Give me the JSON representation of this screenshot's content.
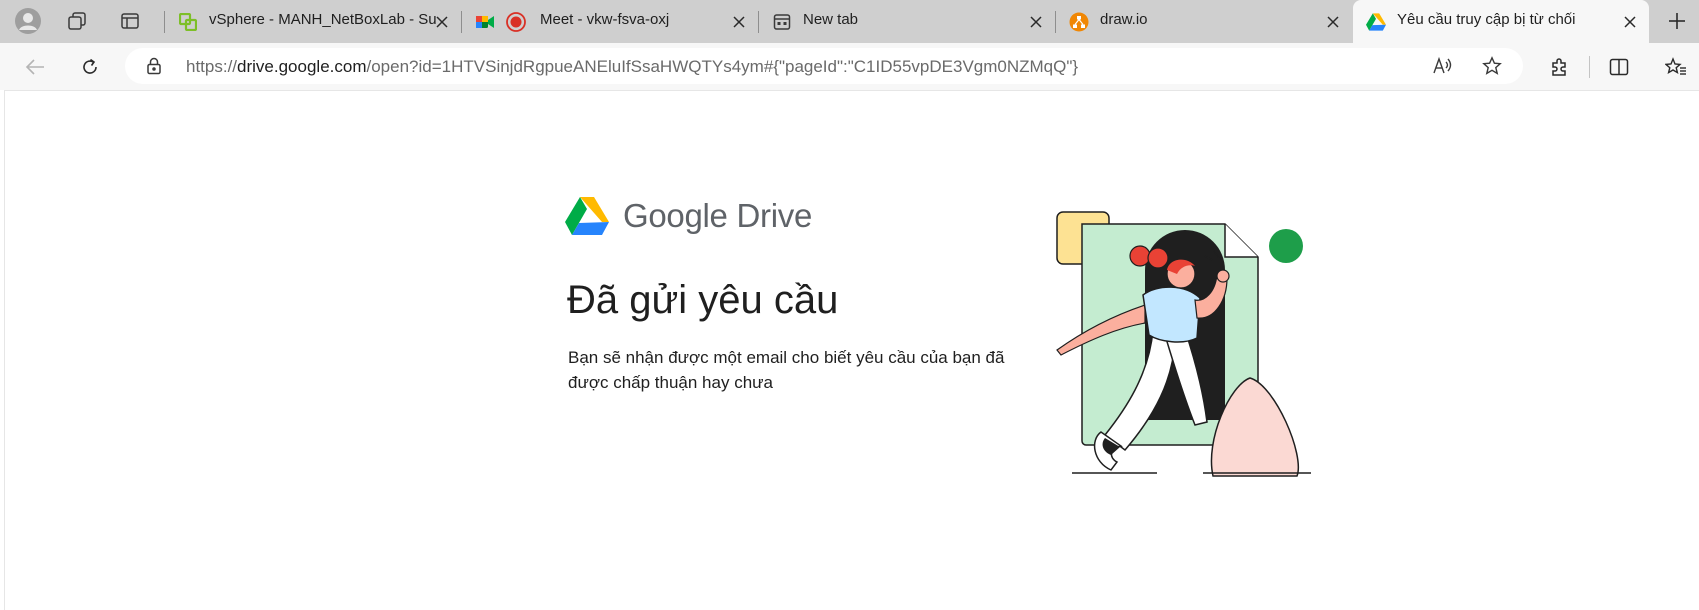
{
  "browser": {
    "tabs": [
      {
        "title": "vSphere - MANH_NetBoxLab - Su",
        "favicon": "vsphere-icon",
        "active": false
      },
      {
        "title": "Meet - vkw-fsva-oxj",
        "favicon": "google-meet-icon",
        "active": false,
        "recording": true
      },
      {
        "title": "New tab",
        "favicon": "new-tab-icon",
        "active": false
      },
      {
        "title": "draw.io",
        "favicon": "drawio-icon",
        "active": false
      },
      {
        "title": "Yêu cầu truy cập bị từ chối",
        "favicon": "google-drive-icon",
        "active": true
      }
    ],
    "address_bar": {
      "scheme": "https://",
      "host": "drive.google.com",
      "path": "/open?id=1HTVSinjdRgpueANEluIfSsaHWQTYs4ym#{\"pageId\":\"C1ID55vpDE3Vgm0NZMqQ\"}"
    }
  },
  "page": {
    "brand": {
      "google": "Google",
      "product": "Drive"
    },
    "heading": "Đã gửi yêu cầu",
    "description": "Bạn sẽ nhận được một email cho biết yêu cầu của bạn đã được chấp thuận hay chưa"
  },
  "colors": {
    "tabstrip": "#cfcfcf",
    "toolbar": "#f7f7f7",
    "illustration_green": "#c4ecd0",
    "illustration_dot": "#1e9e4a",
    "illustration_peach": "#fbd9d3",
    "illustration_yellow": "#fde293",
    "illustration_red": "#e94235",
    "illustration_blue": "#c2e7ff"
  }
}
